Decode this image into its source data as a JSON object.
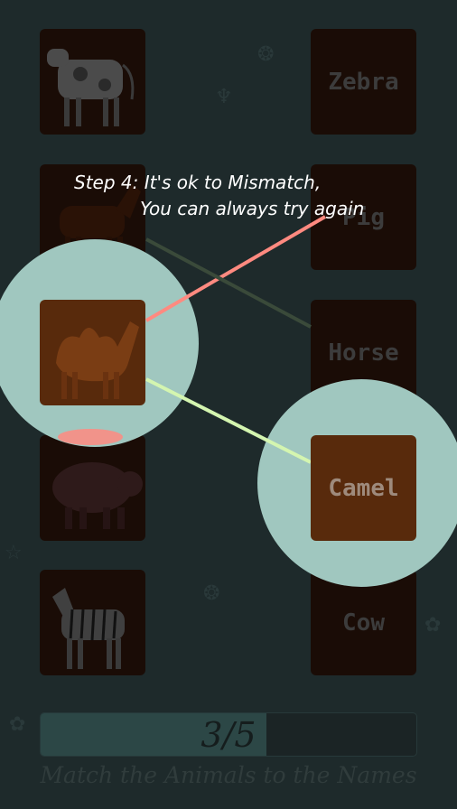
{
  "tutorial": {
    "line1": "Step 4: It's ok to Mismatch,",
    "line2": "You can always try again"
  },
  "left_column": [
    {
      "animal": "cow",
      "icon": "cow-icon"
    },
    {
      "animal": "horse",
      "icon": "horse-icon"
    },
    {
      "animal": "camel",
      "icon": "camel-icon"
    },
    {
      "animal": "pig",
      "icon": "pig-icon"
    },
    {
      "animal": "zebra",
      "icon": "zebra-icon"
    }
  ],
  "right_column": [
    {
      "label": "Zebra"
    },
    {
      "label": "Pig"
    },
    {
      "label": "Horse"
    },
    {
      "label": "Camel"
    },
    {
      "label": "Cow"
    }
  ],
  "progress": {
    "text": "3/5",
    "fraction": 0.6
  },
  "footer": "Match the Animals to the Names",
  "colors": {
    "background": "#1e2a2b",
    "card": "#1a0c06",
    "spotlight": "#a0c7bf",
    "mismatch_line": "#ff8a80",
    "match_line": "#d4f5b0"
  }
}
